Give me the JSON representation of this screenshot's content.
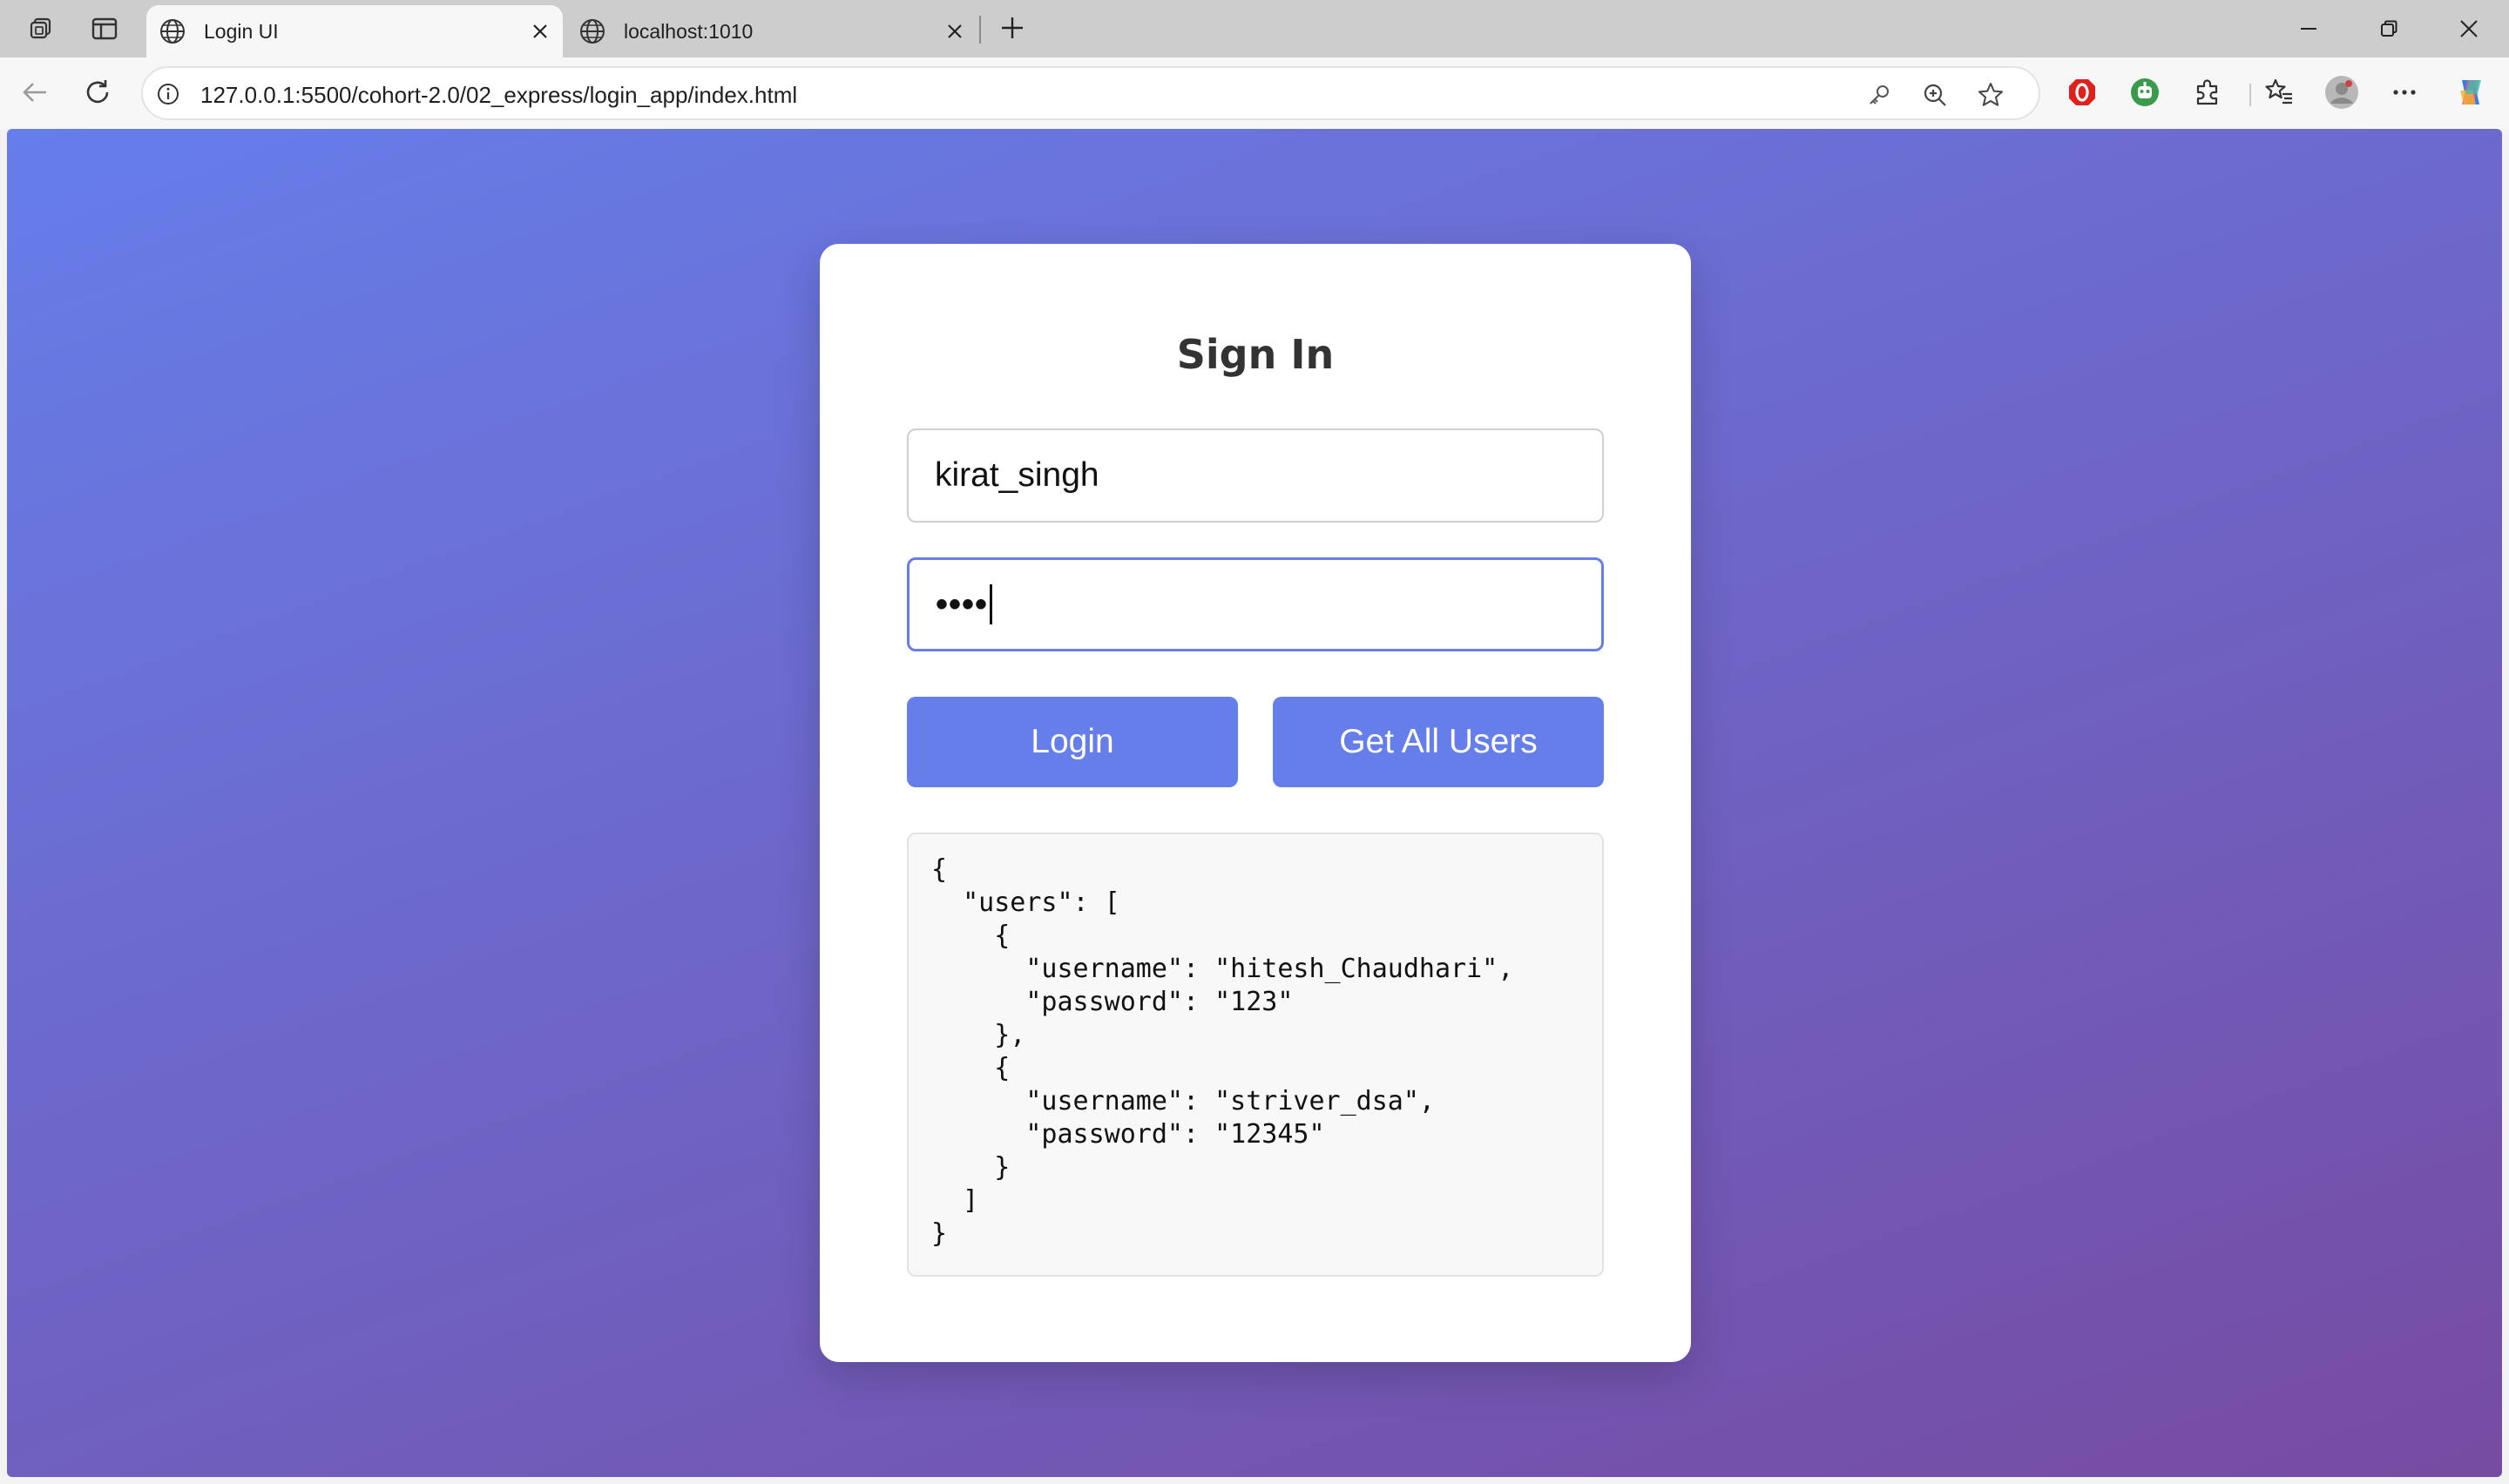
{
  "browser": {
    "tabs": [
      {
        "title": "Login UI",
        "active": true
      },
      {
        "title": "localhost:1010",
        "active": false
      }
    ],
    "address": "127.0.0.1:5500/cohort-2.0/02_express/login_app/index.html",
    "colors": {
      "tabbar": "#cdcdcd",
      "toolbar": "#f7f7f7"
    }
  },
  "page": {
    "heading": "Sign In",
    "username_value": "kirat_singh",
    "password_masked": "••••",
    "login_label": "Login",
    "get_all_label": "Get All Users",
    "output": "{\n  \"users\": [\n    {\n      \"username\": \"hitesh_Chaudhari\",\n      \"password\": \"123\"\n    },\n    {\n      \"username\": \"striver_dsa\",\n      \"password\": \"12345\"\n    }\n  ]\n}",
    "colors": {
      "gradient_start": "#667eea",
      "gradient_end": "#764ba2",
      "button": "#667eea"
    }
  },
  "icons": [
    "workspaces-icon",
    "vertical-tabs-icon",
    "globe-icon",
    "close-icon",
    "new-tab-icon",
    "minimize-icon",
    "restore-icon",
    "window-close-icon",
    "back-icon",
    "refresh-icon",
    "info-icon",
    "key-icon",
    "zoom-icon",
    "favorite-star-icon",
    "extension-red-icon",
    "extension-green-icon",
    "extensions-puzzle-icon",
    "favorites-icon",
    "profile-avatar-icon",
    "more-icon",
    "copilot-icon"
  ]
}
